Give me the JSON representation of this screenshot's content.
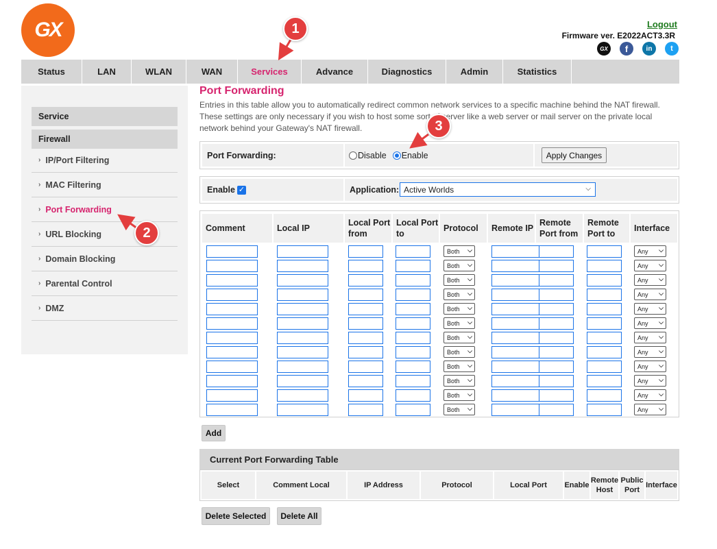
{
  "brand": {
    "logo_text": "GX",
    "accent_color": "#d6246e",
    "logo_color": "#f26a1b"
  },
  "header": {
    "logout": "Logout",
    "firmware": "Firmware ver. E2022ACT3.3R",
    "social_icons": [
      "gx-icon",
      "facebook-icon",
      "linkedin-icon",
      "twitter-icon"
    ]
  },
  "nav": {
    "tabs": [
      "Status",
      "LAN",
      "WLAN",
      "WAN",
      "Services",
      "Advance",
      "Diagnostics",
      "Admin",
      "Statistics"
    ],
    "active": "Services"
  },
  "sidebar": {
    "sections": [
      "Service",
      "Firewall"
    ],
    "items": [
      "IP/Port Filtering",
      "MAC Filtering",
      "Port Forwarding",
      "URL Blocking",
      "Domain Blocking",
      "Parental Control",
      "DMZ"
    ],
    "active": "Port Forwarding"
  },
  "page": {
    "title": "Port Forwarding",
    "description": "Entries in this table allow you to automatically redirect common network services to a specific machine behind the NAT firewall. These settings are only necessary if you wish to host some sort of server like a web server or mail server on the private local network behind your Gateway's NAT firewall."
  },
  "port_forwarding": {
    "label": "Port Forwarding:",
    "disable": "Disable",
    "enable": "Enable",
    "selected": "Enable",
    "apply": "Apply Changes"
  },
  "app_row": {
    "enable_label": "Enable",
    "enable_checked": true,
    "application_label": "Application:",
    "application_value": "Active Worlds"
  },
  "entry_table": {
    "headers": [
      "Comment",
      "Local IP",
      "Local Port from",
      "Local Port to",
      "Protocol",
      "Remote IP",
      "Remote Port from",
      "Remote Port to",
      "Interface"
    ],
    "row_count": 12,
    "protocol_value": "Both",
    "interface_value": "Any"
  },
  "add_button": "Add",
  "current_table": {
    "title": "Current Port Forwarding Table",
    "headers": [
      "Select",
      "Comment Local",
      "IP Address",
      "Protocol",
      "Local Port",
      "Enable",
      "Remote Host",
      "Public Port",
      "Interface"
    ]
  },
  "actions": {
    "delete_selected": "Delete Selected",
    "delete_all": "Delete All"
  },
  "annotations": [
    "1",
    "2",
    "3"
  ]
}
